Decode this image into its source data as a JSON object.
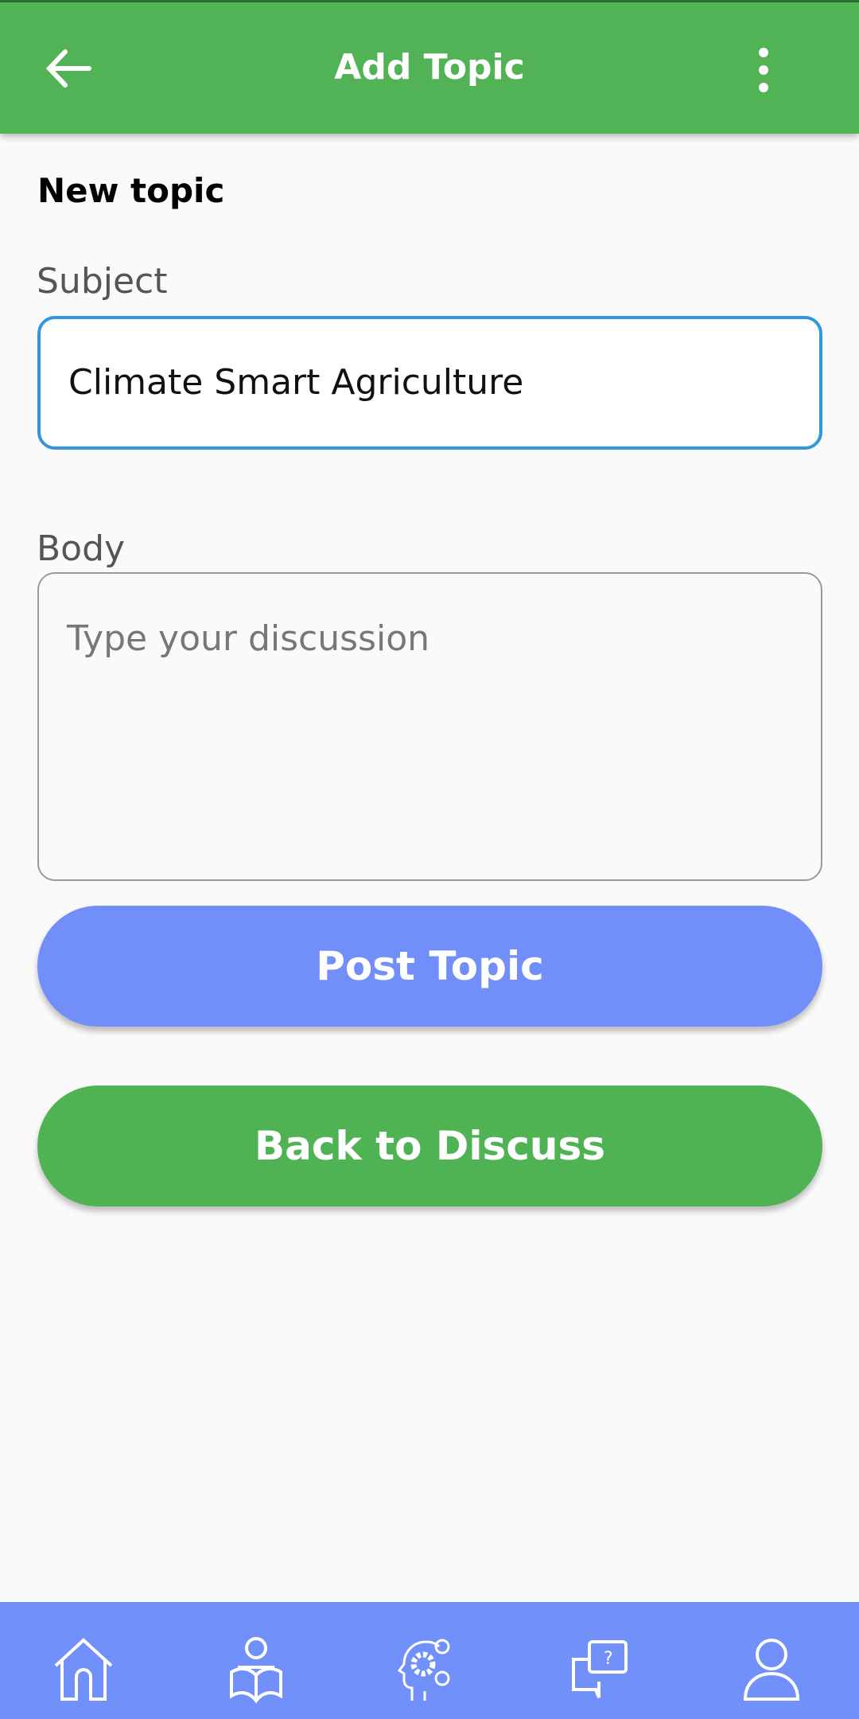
{
  "header": {
    "title": "Add Topic",
    "back_icon": "arrow-left-icon",
    "menu_icon": "more-vertical-icon"
  },
  "form": {
    "heading": "New topic",
    "subject_label": "Subject",
    "subject_value": "Climate Smart Agriculture",
    "body_label": "Body",
    "body_placeholder": "Type your discussion"
  },
  "buttons": {
    "post": "Post Topic",
    "back": "Back to Discuss"
  },
  "colors": {
    "header": "#51b355",
    "primary": "#728ff9",
    "green_button": "#4fb354",
    "focus_border": "#2f96e0"
  },
  "bottom_nav": [
    "home-icon",
    "reader-icon",
    "brain-gears-icon",
    "question-chat-icon",
    "profile-icon"
  ]
}
